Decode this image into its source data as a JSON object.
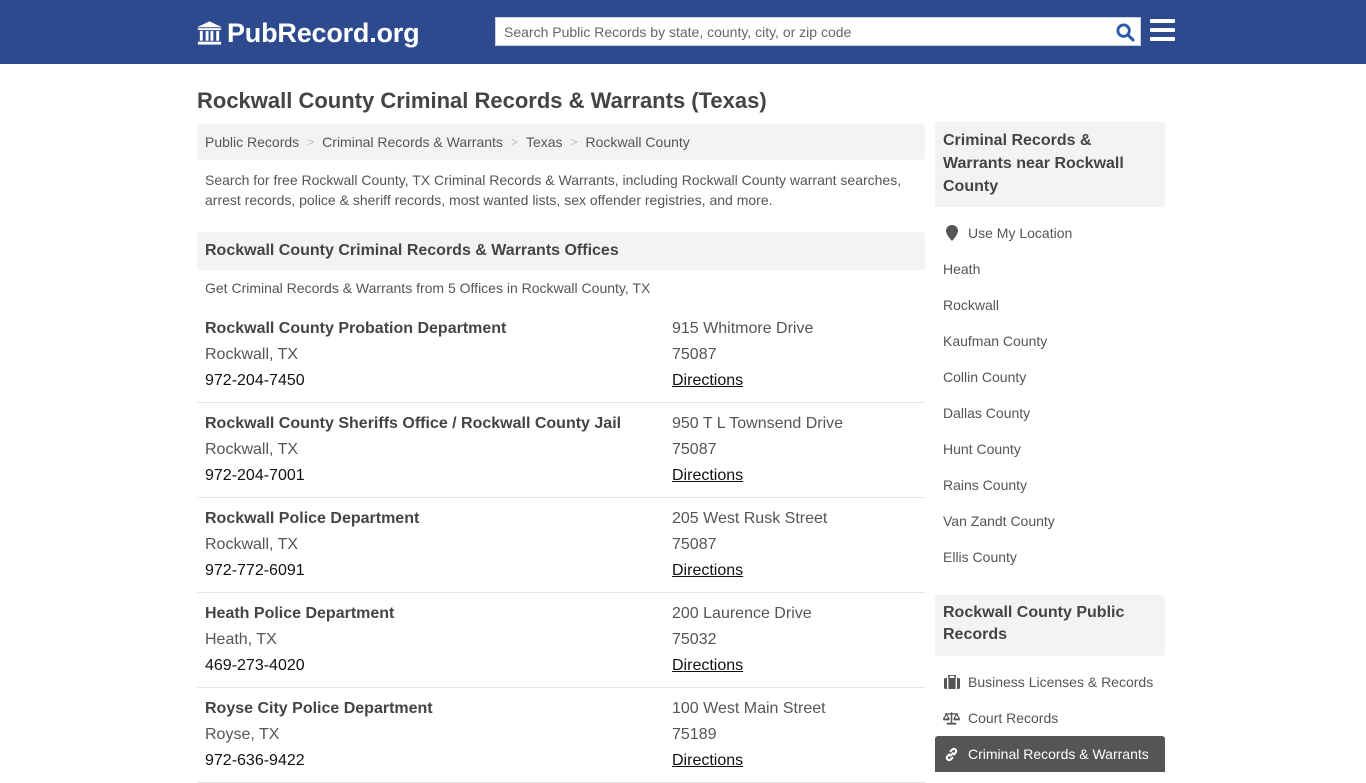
{
  "header": {
    "logo_text": "PubRecord.org",
    "search_placeholder": "Search Public Records by state, county, city, or zip code",
    "brand_color": "#2e4a8e"
  },
  "page_title": "Rockwall County Criminal Records & Warrants (Texas)",
  "breadcrumb": [
    "Public Records",
    "Criminal Records & Warrants",
    "Texas",
    "Rockwall County"
  ],
  "intro": "Search for free Rockwall County, TX Criminal Records & Warrants, including Rockwall County warrant searches, arrest records, police & sheriff records, most wanted lists, sex offender registries, and more.",
  "offices_section": {
    "title": "Rockwall County Criminal Records & Warrants Offices",
    "subtitle": "Get Criminal Records & Warrants from 5 Offices in Rockwall County, TX",
    "offices": [
      {
        "name": "Rockwall County Probation Department",
        "city": "Rockwall, TX",
        "phone": "972-204-7450",
        "address": "915 Whitmore Drive",
        "zip": "75087",
        "directions": "Directions"
      },
      {
        "name": "Rockwall County Sheriffs Office / Rockwall County Jail",
        "city": "Rockwall, TX",
        "phone": "972-204-7001",
        "address": "950 T L Townsend Drive",
        "zip": "75087",
        "directions": "Directions"
      },
      {
        "name": "Rockwall Police Department",
        "city": "Rockwall, TX",
        "phone": "972-772-6091",
        "address": "205 West Rusk Street",
        "zip": "75087",
        "directions": "Directions"
      },
      {
        "name": "Heath Police Department",
        "city": "Heath, TX",
        "phone": "469-273-4020",
        "address": "200 Laurence Drive",
        "zip": "75032",
        "directions": "Directions"
      },
      {
        "name": "Royse City Police Department",
        "city": "Royse, TX",
        "phone": "972-636-9422",
        "address": "100 West Main Street",
        "zip": "75189",
        "directions": "Directions"
      }
    ]
  },
  "sidebar": {
    "near_title": "Criminal Records & Warrants near Rockwall County",
    "use_location": "Use My Location",
    "near_items": [
      "Heath",
      "Rockwall",
      "Kaufman County",
      "Collin County",
      "Dallas County",
      "Hunt County",
      "Rains County",
      "Van Zandt County",
      "Ellis County"
    ],
    "county_title": "Rockwall County Public Records",
    "county_items": [
      {
        "label": "Business Licenses & Records",
        "icon": "briefcase-icon"
      },
      {
        "label": "Court Records",
        "icon": "balance-scale-icon"
      },
      {
        "label": "Criminal Records & Warrants",
        "icon": "link-icon",
        "active": true
      }
    ]
  }
}
